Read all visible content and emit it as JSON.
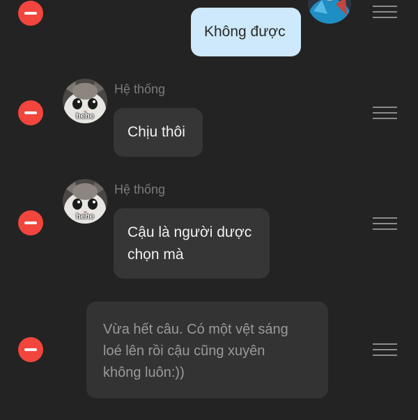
{
  "messages": [
    {
      "type": "outgoing",
      "text": "Không được"
    },
    {
      "type": "incoming",
      "sender": "Hệ thống",
      "avatar_caption": "hehe",
      "text": "Chịu thôi"
    },
    {
      "type": "incoming",
      "sender": "Hệ thống",
      "avatar_caption": "hehe",
      "text": "Cậu là người dược\nchọn mà"
    },
    {
      "type": "narration",
      "text": "Vừa hết câu. Có một vệt sáng\nloé lên rồi cậu cũng xuyên\nkhông luôn:))"
    }
  ],
  "colors": {
    "background": "#232323",
    "remove_button": "#f2453d",
    "outgoing_bubble": "#cde9fb",
    "incoming_bubble": "#363636"
  },
  "icons": [
    "remove-circle-icon",
    "drag-handle-icon"
  ]
}
